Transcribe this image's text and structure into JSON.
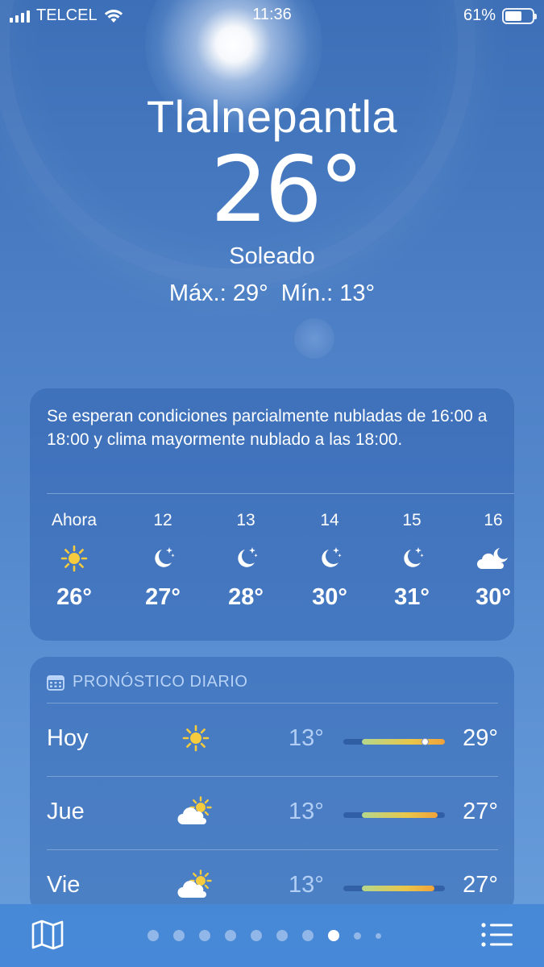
{
  "status_bar": {
    "carrier": "TELCEL",
    "time": "11:36",
    "battery": "61%",
    "battery_level": 0.61
  },
  "location": {
    "city": "Tlalnepantla",
    "temperature": "26°",
    "condition": "Soleado",
    "high": "Máx.: 29°",
    "low": "Mín.: 13°"
  },
  "hourly": {
    "summary": "Se esperan condiciones parcialmente nubladas de 16:00 a 18:00 y clima mayormente nublado a las 18:00.",
    "hours": [
      {
        "label": "Ahora",
        "icon": "sun-icon",
        "temp": "26°"
      },
      {
        "label": "12",
        "icon": "moon-stars-icon",
        "temp": "27°"
      },
      {
        "label": "13",
        "icon": "moon-stars-icon",
        "temp": "28°"
      },
      {
        "label": "14",
        "icon": "moon-stars-icon",
        "temp": "30°"
      },
      {
        "label": "15",
        "icon": "moon-stars-icon",
        "temp": "31°"
      },
      {
        "label": "16",
        "icon": "cloud-moon-icon",
        "temp": "30°"
      }
    ]
  },
  "daily": {
    "header": "PRONÓSTICO DIARIO",
    "days": [
      {
        "day": "Hoy",
        "icon": "sun-icon",
        "low": "13°",
        "high": "29°",
        "range_start": 0.18,
        "range_end": 1.0,
        "current": 0.8
      },
      {
        "day": "Jue",
        "icon": "cloud-sun-icon",
        "low": "13°",
        "high": "27°",
        "range_start": 0.18,
        "range_end": 0.93
      },
      {
        "day": "Vie",
        "icon": "cloud-sun-icon",
        "low": "13°",
        "high": "27°",
        "range_start": 0.18,
        "range_end": 0.9
      }
    ]
  },
  "colors": {
    "sun": "#f6cb3d",
    "range_cool": "#b5d78c",
    "range_warm": "#f0a23a"
  },
  "bottom_bar": {
    "page_count": 10,
    "active_page": 8
  }
}
